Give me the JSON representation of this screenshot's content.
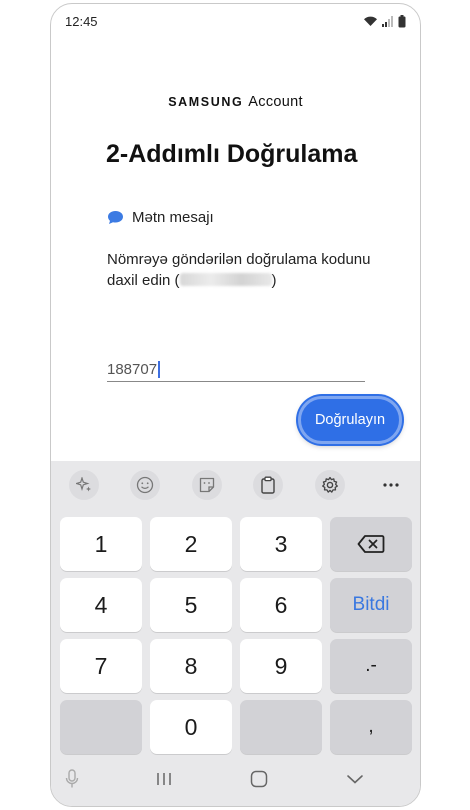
{
  "status_bar": {
    "time": "12:45"
  },
  "brand": {
    "samsung": "SAMSUNG",
    "account": "Account"
  },
  "page": {
    "title": "2-Addımlı Doğrulama",
    "method_label": "Mətn mesajı",
    "instruction_prefix": "Nömrəyə göndərilən doğrulama kodunu daxil edin (",
    "instruction_suffix": ")",
    "code_value": "188707",
    "verify_label": "Doğrulayın"
  },
  "keyboard": {
    "keys": [
      {
        "label": "1",
        "type": "digit"
      },
      {
        "label": "2",
        "type": "digit"
      },
      {
        "label": "3",
        "type": "digit"
      },
      {
        "label": "backspace",
        "type": "backspace"
      },
      {
        "label": "4",
        "type": "digit"
      },
      {
        "label": "5",
        "type": "digit"
      },
      {
        "label": "6",
        "type": "digit"
      },
      {
        "label": "Bitdi",
        "type": "done"
      },
      {
        "label": "7",
        "type": "digit"
      },
      {
        "label": "8",
        "type": "digit"
      },
      {
        "label": "9",
        "type": "digit"
      },
      {
        "label": ".-",
        "type": "symbol"
      },
      {
        "label": "",
        "type": "blank"
      },
      {
        "label": "0",
        "type": "digit"
      },
      {
        "label": "",
        "type": "blank"
      },
      {
        "label": ",",
        "type": "symbol"
      }
    ]
  },
  "colors": {
    "accent": "#2f6fe6",
    "keyboard_bg": "#e8e8ea",
    "done_text": "#3a78e0"
  }
}
